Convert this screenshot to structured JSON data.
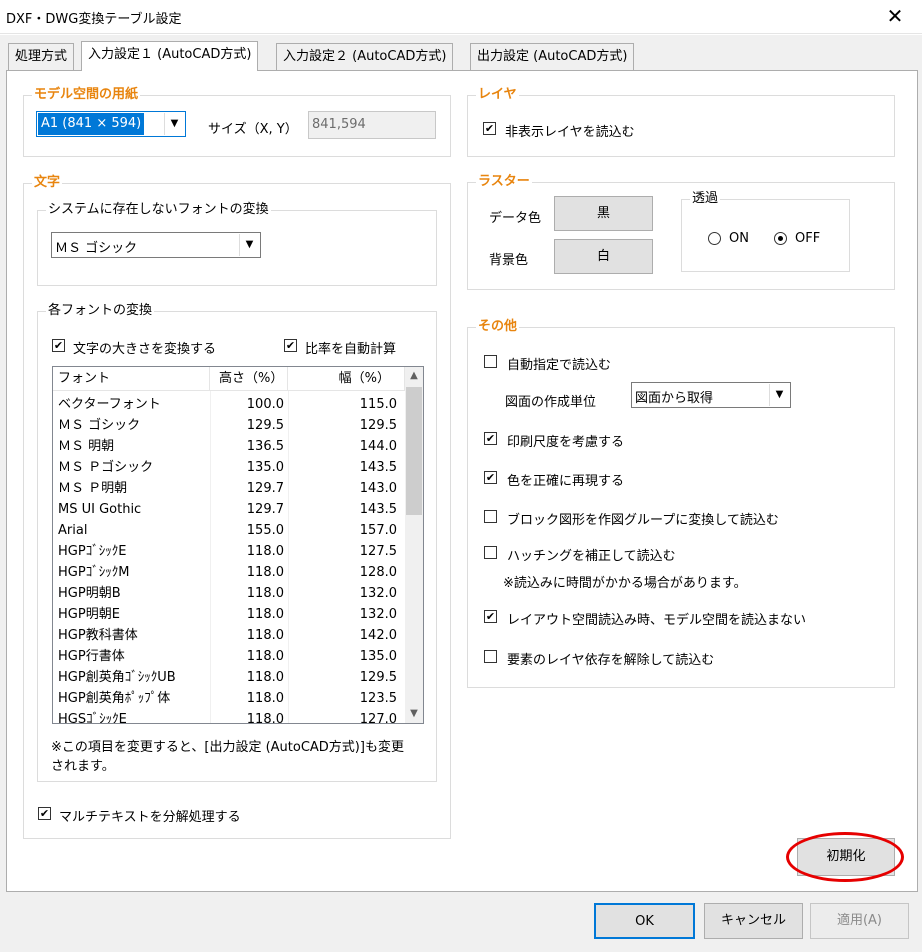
{
  "window": {
    "title": "DXF・DWG変換テーブル設定",
    "close_glyph": "✕"
  },
  "tabs": [
    {
      "label": "処理方式",
      "active": false
    },
    {
      "label": "入力設定１ (AutoCAD方式)",
      "active": true
    },
    {
      "label": "入力設定２ (AutoCAD方式)",
      "active": false
    },
    {
      "label": "出力設定 (AutoCAD方式)",
      "active": false
    }
  ],
  "paper": {
    "group_label": "モデル空間の用紙",
    "size_value": "A1 (841 × 594)",
    "size_label": "サイズ（X, Y）",
    "xy_value": "841,594"
  },
  "text": {
    "group_label": "文字",
    "missing_font": {
      "group_label": "システムに存在しないフォントの変換",
      "value": "ＭＳ ゴシック"
    },
    "font_conv": {
      "group_label": "各フォントの変換",
      "convert_size": {
        "label": "文字の大きさを変換する",
        "checked": true
      },
      "auto_ratio": {
        "label": "比率を自動計算",
        "checked": true
      },
      "columns": [
        "フォント",
        "高さ（%）",
        "幅（%）"
      ],
      "rows": [
        [
          "ベクターフォント",
          "100.0",
          "115.0"
        ],
        [
          "ＭＳ ゴシック",
          "129.5",
          "129.5"
        ],
        [
          "ＭＳ 明朝",
          "136.5",
          "144.0"
        ],
        [
          "ＭＳ Ｐゴシック",
          "135.0",
          "143.5"
        ],
        [
          "ＭＳ Ｐ明朝",
          "129.7",
          "143.0"
        ],
        [
          "MS UI Gothic",
          "129.7",
          "143.5"
        ],
        [
          "Arial",
          "155.0",
          "157.0"
        ],
        [
          "HGPｺﾞｼｯｸE",
          "118.0",
          "127.5"
        ],
        [
          "HGPｺﾞｼｯｸM",
          "118.0",
          "128.0"
        ],
        [
          "HGP明朝B",
          "118.0",
          "132.0"
        ],
        [
          "HGP明朝E",
          "118.0",
          "132.0"
        ],
        [
          "HGP教科書体",
          "118.0",
          "142.0"
        ],
        [
          "HGP行書体",
          "118.0",
          "135.0"
        ],
        [
          "HGP創英角ｺﾞｼｯｸUB",
          "118.0",
          "129.5"
        ],
        [
          "HGP創英角ﾎﾟｯﾌﾟ体",
          "118.0",
          "123.5"
        ],
        [
          "HGSｺﾞｼｯｸE",
          "118.0",
          "127.0"
        ]
      ],
      "note_line1": "※この項目を変更すると、[出力設定 (AutoCAD方式)]も変更",
      "note_line2": "されます。"
    },
    "mtext": {
      "label": "マルチテキストを分解処理する",
      "checked": true
    }
  },
  "layer": {
    "group_label": "レイヤ",
    "hidden": {
      "label": "非表示レイヤを読込む",
      "checked": true
    }
  },
  "raster": {
    "group_label": "ラスター",
    "data_color_label": "データ色",
    "data_color_value": "黒",
    "bg_color_label": "背景色",
    "bg_color_value": "白",
    "transparency": {
      "group_label": "透過",
      "on_label": "ON",
      "off_label": "OFF",
      "selected": "OFF"
    }
  },
  "other": {
    "group_label": "その他",
    "auto_read": {
      "label": "自動指定で読込む",
      "checked": false
    },
    "unit_label": "図面の作成単位",
    "unit_value": "図面から取得",
    "print_scale": {
      "label": "印刷尺度を考慮する",
      "checked": true
    },
    "color_exact": {
      "label": "色を正確に再現する",
      "checked": true
    },
    "block_to_group": {
      "label": "ブロック図形を作図グループに変換して読込む",
      "checked": false
    },
    "hatch_fix": {
      "label": "ハッチングを補正して読込む",
      "checked": false
    },
    "hatch_note": "※読込みに時間がかかる場合があります。",
    "layout_skip_model": {
      "label": "レイアウト空間読込み時、モデル空間を読込まない",
      "checked": true
    },
    "layer_dep": {
      "label": "要素のレイヤ依存を解除して読込む",
      "checked": false
    }
  },
  "buttons": {
    "reset": "初期化",
    "ok": "OK",
    "cancel": "キャンセル",
    "apply": "適用(A)"
  },
  "glyphs": {
    "check": "✔",
    "dropdown": "▼",
    "scroll_up": "▲",
    "scroll_down": "▼"
  },
  "colors": {
    "accent_label": "#e8850f",
    "highlight": "#0078d7",
    "annotation_circle": "#e60000"
  }
}
